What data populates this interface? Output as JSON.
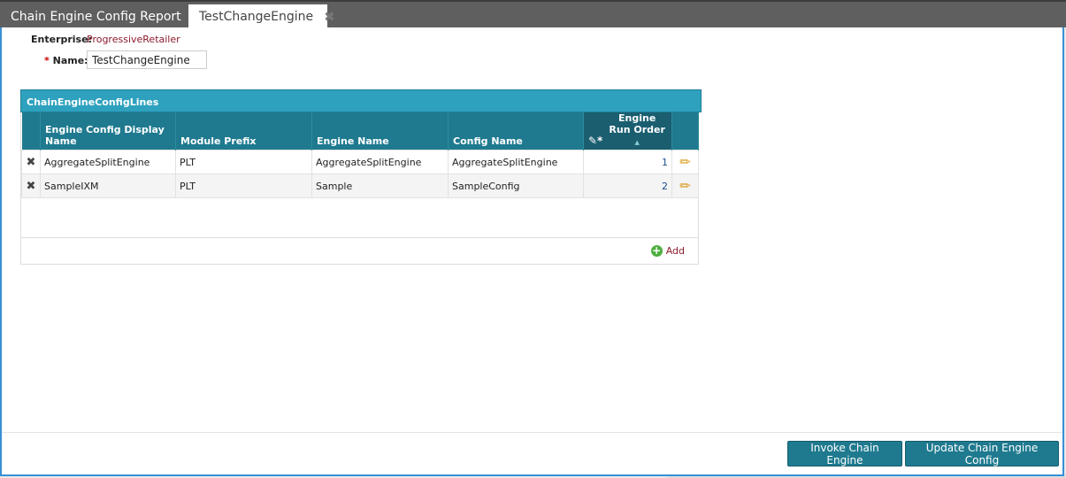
{
  "tabs": [
    {
      "label": "Chain Engine Config Report",
      "close": "✖"
    },
    {
      "label": "TestChangeEngine",
      "close": "✖"
    }
  ],
  "form": {
    "enterprise_label": "Enterprise:",
    "enterprise_value": "ProgressiveRetailer",
    "required_mark": "*",
    "name_label": "Name:",
    "name_value": "TestChangeEngine"
  },
  "panel": {
    "title": "ChainEngineConfigLines"
  },
  "columns": [
    "Engine Config Display Name",
    "Module Prefix",
    "Engine Name",
    "Config Name",
    "Engine Run Order"
  ],
  "sort_indicator": "▲",
  "rows": [
    {
      "display_name": "AggregateSplitEngine",
      "module_prefix": "PLT",
      "engine_name": "AggregateSplitEngine",
      "config_name": "AggregateSplitEngine",
      "run_order": "1"
    },
    {
      "display_name": "SampleIXM",
      "module_prefix": "PLT",
      "engine_name": "Sample",
      "config_name": "SampleConfig",
      "run_order": "2"
    }
  ],
  "add_label": "Add",
  "buttons": {
    "invoke": "Invoke Chain Engine",
    "update": "Update Chain Engine Config"
  },
  "colors": {
    "panel_header": "#2ea1be",
    "column_header": "#1f7a8f",
    "button": "#1f7a8f",
    "link": "#8b1a2b"
  }
}
